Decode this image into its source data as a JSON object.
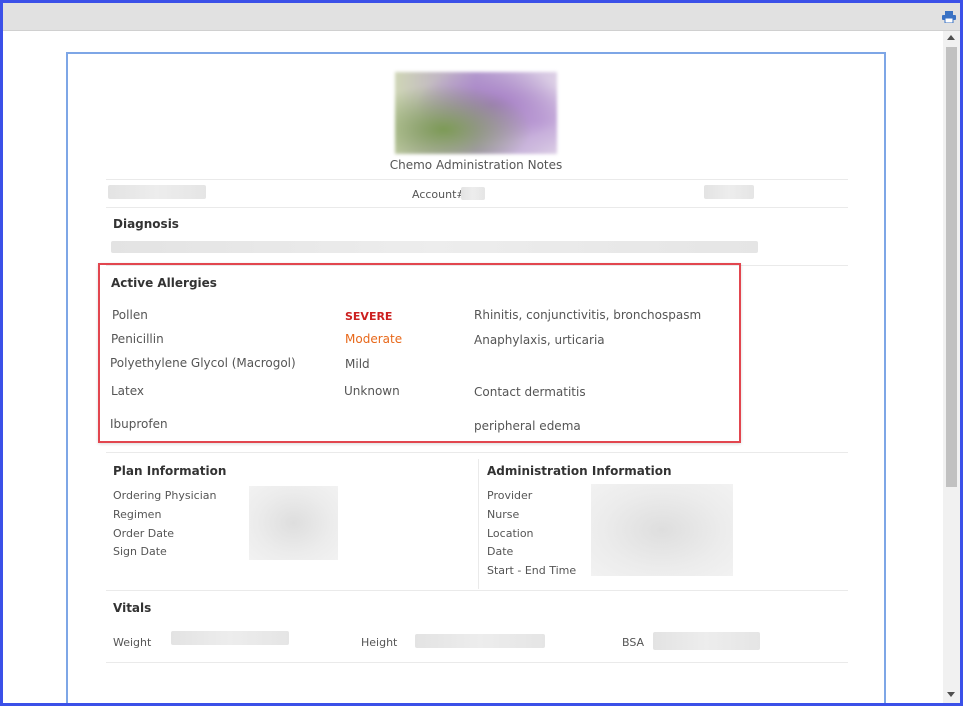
{
  "toolbar": {
    "print_icon": "print-icon"
  },
  "document": {
    "title": "Chemo Administration Notes",
    "account_label": "Account#"
  },
  "diagnosis": {
    "title": "Diagnosis"
  },
  "allergies": {
    "title": "Active Allergies",
    "items": [
      {
        "name": "Pollen",
        "severity": "SEVERE",
        "reaction": "Rhinitis, conjunctivitis, bronchospasm"
      },
      {
        "name": "Penicillin",
        "severity": "Moderate",
        "reaction": "Anaphylaxis, urticaria"
      },
      {
        "name": "Polyethylene Glycol (Macrogol)",
        "severity": "Mild",
        "reaction": ""
      },
      {
        "name": "Latex",
        "severity": "Unknown",
        "reaction": "Contact dermatitis"
      },
      {
        "name": "Ibuprofen",
        "severity": "",
        "reaction": "peripheral edema"
      }
    ],
    "colors": {
      "severe": "#cc1f1f",
      "moderate": "#e8681a",
      "highlight": "#e2464f"
    }
  },
  "plan": {
    "title": "Plan Information",
    "labels": [
      "Ordering Physician",
      "Regimen",
      "Order Date",
      "Sign Date"
    ]
  },
  "administration": {
    "title": "Administration  Information",
    "labels": [
      "Provider",
      "Nurse",
      "Location",
      "Date",
      "Start - End Time"
    ]
  },
  "vitals": {
    "title": "Vitals",
    "weight_label": "Weight",
    "height_label": "Height",
    "bsa_label": "BSA"
  }
}
